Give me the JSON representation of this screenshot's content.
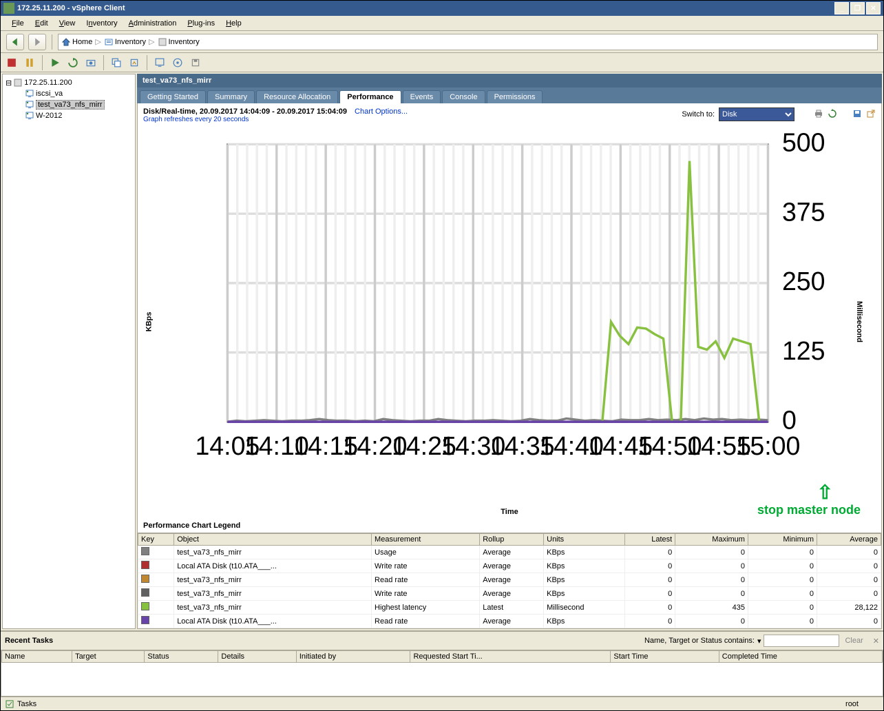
{
  "window": {
    "title": "172.25.11.200 - vSphere Client"
  },
  "menu": {
    "file": "File",
    "edit": "Edit",
    "view": "View",
    "inventory": "Inventory",
    "administration": "Administration",
    "plugins": "Plug-ins",
    "help": "Help"
  },
  "breadcrumb": {
    "home": "Home",
    "inventory1": "Inventory",
    "inventory2": "Inventory"
  },
  "tree": {
    "root": "172.25.11.200",
    "items": [
      {
        "label": "iscsi_va"
      },
      {
        "label": "test_va73_nfs_mirr",
        "selected": true
      },
      {
        "label": "W-2012"
      }
    ]
  },
  "main": {
    "title": "test_va73_nfs_mirr"
  },
  "tabs": [
    {
      "label": "Getting Started"
    },
    {
      "label": "Summary"
    },
    {
      "label": "Resource Allocation"
    },
    {
      "label": "Performance",
      "active": true
    },
    {
      "label": "Events"
    },
    {
      "label": "Console"
    },
    {
      "label": "Permissions"
    }
  ],
  "perf": {
    "title": "Disk/Real-time, 20.09.2017 14:04:09 - 20.09.2017 15:04:09",
    "options_link": "Chart Options...",
    "refresh_note": "Graph refreshes every 20 seconds",
    "switch_label": "Switch to:",
    "switch_value": "Disk",
    "ylabel_left": "KBps",
    "ylabel_right": "Millisecond",
    "xlabel": "Time",
    "annotation": "stop master node"
  },
  "chart_data": {
    "type": "line",
    "xlabel": "Time",
    "ylabel_left": "KBps",
    "ylabel_right": "Millisecond",
    "ylim": [
      0,
      500
    ],
    "yticks": [
      0,
      125,
      250,
      375,
      500
    ],
    "categories": [
      "14:05",
      "14:10",
      "14:15",
      "14:20",
      "14:25",
      "14:30",
      "14:35",
      "14:40",
      "14:45",
      "14:50",
      "14:55",
      "15:00"
    ],
    "minor_per_major": 5,
    "series": [
      {
        "name": "Usage KBps (test_va73_nfs_mirr)",
        "color": "#808080",
        "values": [
          0,
          2,
          1,
          2,
          3,
          2,
          1,
          2,
          2,
          3,
          5,
          3,
          2,
          2,
          1,
          2,
          1,
          5,
          3,
          2,
          1,
          2,
          2,
          5,
          3,
          2,
          1,
          2,
          2,
          3,
          2,
          1,
          2,
          5,
          3,
          2,
          2,
          6,
          4,
          2,
          3,
          2,
          1,
          4,
          3,
          3,
          5,
          3,
          4,
          3,
          5,
          3,
          6,
          4,
          5,
          3,
          4,
          3,
          4,
          3
        ]
      },
      {
        "name": "Write rate KBps (Local ATA Disk)",
        "color": "#b03030",
        "values": [
          0,
          0,
          0,
          0,
          0,
          0,
          0,
          0,
          0,
          0,
          0,
          0,
          0,
          0,
          0,
          0,
          0,
          0,
          0,
          0,
          0,
          0,
          0,
          0,
          0,
          0,
          0,
          0,
          0,
          0,
          0,
          0,
          0,
          0,
          0,
          0,
          0,
          0,
          0,
          0,
          0,
          0,
          0,
          0,
          0,
          0,
          0,
          0,
          0,
          0,
          0,
          0,
          0,
          0,
          0,
          0,
          0,
          0,
          0,
          0
        ]
      },
      {
        "name": "Read rate KBps (test_va73_nfs_mirr)",
        "color": "#c08830",
        "values": [
          0,
          0,
          0,
          0,
          0,
          0,
          0,
          0,
          0,
          0,
          0,
          0,
          0,
          0,
          0,
          0,
          0,
          0,
          0,
          0,
          0,
          0,
          0,
          0,
          0,
          0,
          0,
          0,
          0,
          0,
          0,
          0,
          0,
          0,
          0,
          0,
          0,
          0,
          0,
          0,
          0,
          0,
          0,
          0,
          0,
          0,
          0,
          0,
          0,
          0,
          0,
          0,
          0,
          0,
          0,
          0,
          0,
          0,
          0,
          0
        ]
      },
      {
        "name": "Write rate KBps (test_va73_nfs_mirr)",
        "color": "#606060",
        "values": [
          0,
          0,
          0,
          0,
          0,
          0,
          0,
          0,
          0,
          0,
          0,
          0,
          0,
          0,
          0,
          0,
          0,
          0,
          0,
          0,
          0,
          0,
          0,
          0,
          0,
          0,
          0,
          0,
          0,
          0,
          0,
          0,
          0,
          0,
          0,
          0,
          0,
          0,
          0,
          0,
          0,
          0,
          0,
          0,
          0,
          0,
          0,
          0,
          0,
          0,
          0,
          0,
          0,
          0,
          0,
          0,
          0,
          0,
          0,
          0
        ]
      },
      {
        "name": "Highest latency ms (test_va73_nfs_mirr)",
        "color": "#88c040",
        "values": [
          0,
          0,
          0,
          0,
          0,
          0,
          0,
          0,
          0,
          0,
          0,
          0,
          0,
          0,
          0,
          0,
          0,
          0,
          0,
          0,
          0,
          0,
          0,
          0,
          0,
          0,
          0,
          0,
          0,
          0,
          0,
          0,
          0,
          0,
          0,
          0,
          0,
          0,
          0,
          0,
          0,
          0,
          0,
          0,
          180,
          155,
          140,
          170,
          168,
          158,
          150,
          0,
          0,
          470,
          135,
          130,
          145,
          115,
          150,
          145,
          140,
          0,
          0
        ]
      },
      {
        "name": "Read rate KBps (Local ATA Disk)",
        "color": "#6844a8",
        "values": [
          0,
          0,
          0,
          0,
          0,
          0,
          0,
          0,
          0,
          0,
          0,
          0,
          0,
          0,
          0,
          0,
          0,
          0,
          0,
          0,
          0,
          0,
          0,
          0,
          0,
          0,
          0,
          0,
          0,
          0,
          0,
          0,
          0,
          0,
          0,
          0,
          0,
          0,
          0,
          0,
          0,
          0,
          0,
          0,
          0,
          0,
          0,
          0,
          0,
          0,
          0,
          0,
          0,
          0,
          0,
          0,
          0,
          0,
          0,
          0
        ]
      }
    ]
  },
  "legend": {
    "title": "Performance Chart Legend",
    "cols": [
      "Key",
      "Object",
      "Measurement",
      "Rollup",
      "Units",
      "Latest",
      "Maximum",
      "Minimum",
      "Average"
    ],
    "rows": [
      {
        "color": "#808080",
        "object": "test_va73_nfs_mirr",
        "measurement": "Usage",
        "rollup": "Average",
        "units": "KBps",
        "latest": "0",
        "max": "0",
        "min": "0",
        "avg": "0"
      },
      {
        "color": "#b03030",
        "object": "Local ATA Disk (t10.ATA___...",
        "measurement": "Write rate",
        "rollup": "Average",
        "units": "KBps",
        "latest": "0",
        "max": "0",
        "min": "0",
        "avg": "0"
      },
      {
        "color": "#c08830",
        "object": "test_va73_nfs_mirr",
        "measurement": "Read rate",
        "rollup": "Average",
        "units": "KBps",
        "latest": "0",
        "max": "0",
        "min": "0",
        "avg": "0"
      },
      {
        "color": "#606060",
        "object": "test_va73_nfs_mirr",
        "measurement": "Write rate",
        "rollup": "Average",
        "units": "KBps",
        "latest": "0",
        "max": "0",
        "min": "0",
        "avg": "0"
      },
      {
        "color": "#88c040",
        "object": "test_va73_nfs_mirr",
        "measurement": "Highest latency",
        "rollup": "Latest",
        "units": "Millisecond",
        "latest": "0",
        "max": "435",
        "min": "0",
        "avg": "28,122"
      },
      {
        "color": "#6844a8",
        "object": "Local ATA Disk (t10.ATA___...",
        "measurement": "Read rate",
        "rollup": "Average",
        "units": "KBps",
        "latest": "0",
        "max": "0",
        "min": "0",
        "avg": "0"
      }
    ]
  },
  "recent_tasks": {
    "title": "Recent Tasks",
    "filter_label": "Name, Target or Status contains:",
    "clear": "Clear",
    "cols": [
      "Name",
      "Target",
      "Status",
      "Details",
      "Initiated by",
      "Requested Start Ti...",
      "Start Time",
      "Completed Time"
    ]
  },
  "status": {
    "tasks": "Tasks",
    "user": "root"
  }
}
